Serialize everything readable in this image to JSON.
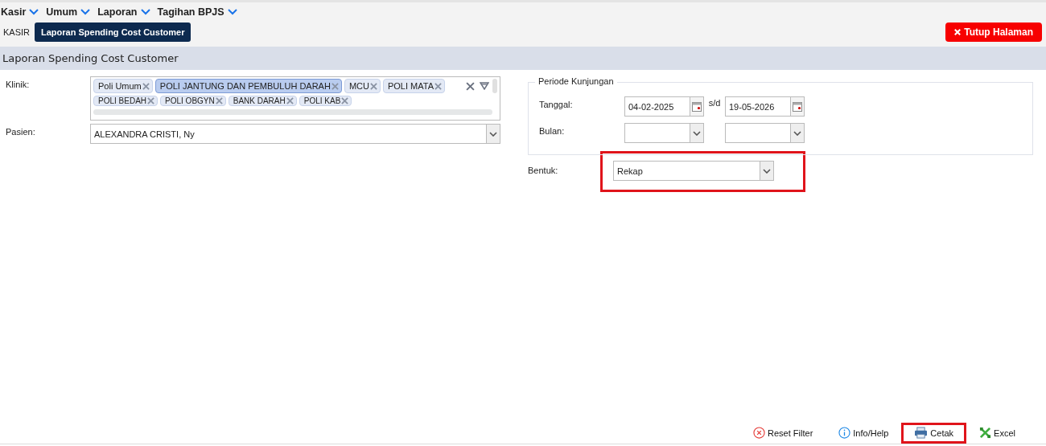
{
  "menu": [
    {
      "label": "Kasir"
    },
    {
      "label": "Umum"
    },
    {
      "label": "Laporan"
    },
    {
      "label": "Tagihan BPJS"
    }
  ],
  "tabs": [
    {
      "label": "KASIR",
      "selected": false
    },
    {
      "label": "Laporan Spending Cost Customer",
      "selected": true
    }
  ],
  "close_button": "Tutup Halaman",
  "section_title": "Laporan Spending Cost Customer",
  "klinik": {
    "label": "Klinik:",
    "tags": [
      {
        "label": "Poli Umum",
        "selected": false
      },
      {
        "label": "POLI JANTUNG DAN PEMBULUH DARAH",
        "selected": true
      },
      {
        "label": "MCU",
        "selected": false
      },
      {
        "label": "POLI MATA",
        "selected": false
      },
      {
        "label": "POLI BEDAH",
        "selected": false
      },
      {
        "label": "POLI OBGYN",
        "selected": false
      },
      {
        "label": "BANK DARAH",
        "selected": false
      },
      {
        "label": "POLI KAB",
        "selected": false
      }
    ]
  },
  "pasien": {
    "label": "Pasien:",
    "value": "ALEXANDRA CRISTI, Ny"
  },
  "periode": {
    "legend": "Periode Kunjungan",
    "tanggal_label": "Tanggal:",
    "tanggal_from": "04-02-2025",
    "separator": "s/d",
    "tanggal_to": "19-05-2026",
    "bulan_label": "Bulan:"
  },
  "bentuk": {
    "label": "Bentuk:",
    "value": "Rekap",
    "highlighted": true
  },
  "actions": [
    {
      "kind": "reset",
      "label": "Reset Filter",
      "highlighted": false
    },
    {
      "kind": "info",
      "label": "Info/Help",
      "highlighted": false
    },
    {
      "kind": "print",
      "label": "Cetak",
      "highlighted": true
    },
    {
      "kind": "excel",
      "label": "Excel",
      "highlighted": false
    }
  ]
}
